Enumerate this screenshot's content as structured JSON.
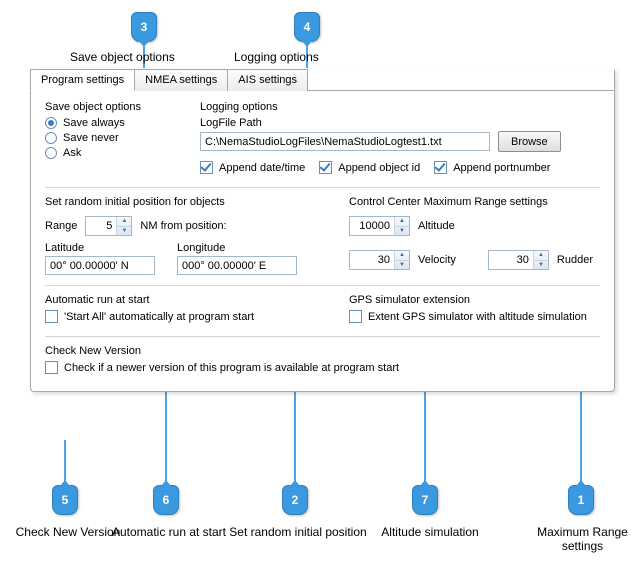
{
  "callouts": {
    "top": {
      "n3": "3",
      "n4": "4",
      "label3": "Save object options",
      "label4": "Logging options"
    },
    "bottom": {
      "n5": "5",
      "label5": "Check New Version",
      "n6": "6",
      "label6": "Automatic run at start",
      "n2": "2",
      "label2": "Set random initial position",
      "n7": "7",
      "label7": "Altitude simulation",
      "n1": "1",
      "label1": "Maximum Range\nsettings"
    }
  },
  "tabs": {
    "program": "Program settings",
    "nmea": "NMEA settings",
    "ais": "AIS settings"
  },
  "saveObject": {
    "title": "Save object options",
    "always": "Save always",
    "never": "Save never",
    "ask": "Ask"
  },
  "logging": {
    "title": "Logging options",
    "pathLabel": "LogFile Path",
    "path": "C:\\NemaStudioLogFiles\\NemaStudioLogtest1.txt",
    "browse": "Browse",
    "appendDate": "Append date/time",
    "appendObj": "Append object id",
    "appendPort": "Append portnumber"
  },
  "randomPos": {
    "title": "Set random initial position for objects",
    "rangeLabel": "Range",
    "range": "5",
    "nmFrom": "NM from position:",
    "latLabel": "Latitude",
    "lat": "00° 00.00000' N",
    "lonLabel": "Longitude",
    "lon": "000° 00.00000' E"
  },
  "ccRange": {
    "title": "Control Center Maximum Range settings",
    "altitude": "10000",
    "altitudeLabel": "Altitude",
    "velocity": "30",
    "velocityLabel": "Velocity",
    "rudder": "30",
    "rudderLabel": "Rudder"
  },
  "autoRun": {
    "title": "Automatic run at start",
    "chk": "'Start All' automatically at program start"
  },
  "gpsExt": {
    "title": "GPS simulator extension",
    "chk": "Extent GPS simulator with altitude simulation"
  },
  "checkVer": {
    "title": "Check New Version",
    "chk": "Check if a newer version of this program is available  at program start"
  }
}
